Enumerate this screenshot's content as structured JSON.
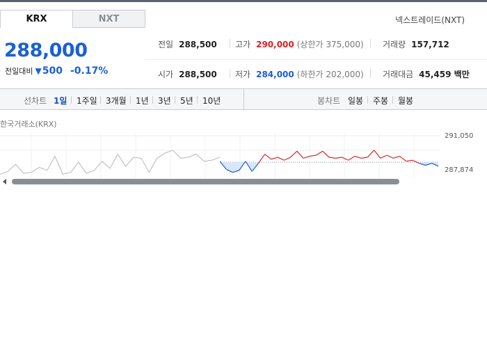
{
  "tabs": [
    "KRX",
    "NXT"
  ],
  "nxt_link": "넥스트레이드(NXT)",
  "quote": {
    "price": "288,000",
    "change_label": "전일대비",
    "change_arrow": "▼",
    "change_amount": "500",
    "change_percent": "-0.17%"
  },
  "stats": {
    "prev_close": {
      "label": "전일",
      "value": "288,500"
    },
    "high": {
      "label": "고가",
      "value": "290,000",
      "sub": "(상한가 375,000)"
    },
    "volume": {
      "label": "거래량",
      "value": "157,712"
    },
    "open": {
      "label": "시가",
      "value": "288,500"
    },
    "low": {
      "label": "저가",
      "value": "284,000",
      "sub": "(하한가 202,000)"
    },
    "amount": {
      "label": "거래대금",
      "value": "45,459 백만"
    }
  },
  "toolbar": {
    "line_label": "선차트",
    "periods": [
      "1일",
      "1주일",
      "3개월",
      "1년",
      "3년",
      "5년",
      "10년"
    ],
    "active_period": "1일",
    "candle_label": "봉차트",
    "candle_periods": [
      "일봉",
      "주봉",
      "월봉"
    ]
  },
  "chart": {
    "title": "한국거래소(KRX)",
    "y_ticks": [
      "291,050",
      "287,874"
    ]
  },
  "chart_data": {
    "type": "line",
    "ylim": [
      287200,
      291200
    ],
    "prev_close": 288500,
    "series": [
      {
        "values": [
          287300,
          287600,
          288300,
          287400,
          287500,
          288000,
          287700,
          289100,
          287300,
          287500,
          288500,
          287400,
          287700,
          288600,
          287900,
          289300,
          288100,
          289000,
          288900,
          287500,
          288900,
          289400,
          289700,
          288900,
          289000,
          289300,
          288600,
          288700,
          289000
        ]
      },
      {
        "values": [
          288600,
          287800,
          287500,
          287700,
          288600,
          287600,
          288400,
          289300,
          288800,
          289000,
          288700,
          289000,
          289600,
          288900,
          289100,
          289200,
          289600,
          289000,
          288900,
          289000,
          288700,
          289100,
          288900,
          289000,
          289700,
          288900,
          289200,
          288900,
          289100,
          288600,
          288700,
          288400,
          288200,
          288400,
          288100
        ]
      }
    ],
    "colors": {
      "up": "#e02020",
      "down": "#1a5fd6",
      "past": "#b8b8b8",
      "fill": "#d9e6fa"
    }
  }
}
